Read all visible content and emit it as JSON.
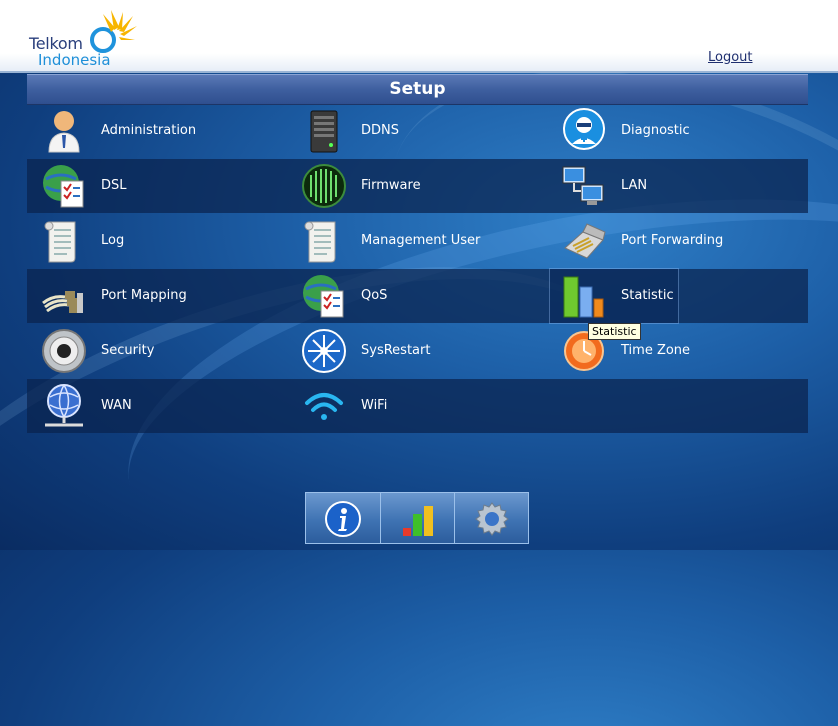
{
  "header": {
    "logo_line1": "Telkom",
    "logo_line2": "Indonesia",
    "logout_label": "Logout"
  },
  "setup_title": "Setup",
  "menu": {
    "administration": "Administration",
    "ddns": "DDNS",
    "diagnostic": "Diagnostic",
    "dsl": "DSL",
    "firmware": "Firmware",
    "lan": "LAN",
    "log": "Log",
    "management_user": "Management User",
    "port_forwarding": "Port Forwarding",
    "port_mapping": "Port Mapping",
    "qos": "QoS",
    "statistic": "Statistic",
    "security": "Security",
    "sysrestart": "SysRestart",
    "time_zone": "Time Zone",
    "wan": "WAN",
    "wifi": "WiFi"
  },
  "tooltip": "Statistic",
  "colors": {
    "header_bg": "#ffffff",
    "setup_bar": "#3e5f9f",
    "row_dark": "#0a234e",
    "logo_blue": "#1e8fd8",
    "logo_sun": "#f7b500"
  }
}
